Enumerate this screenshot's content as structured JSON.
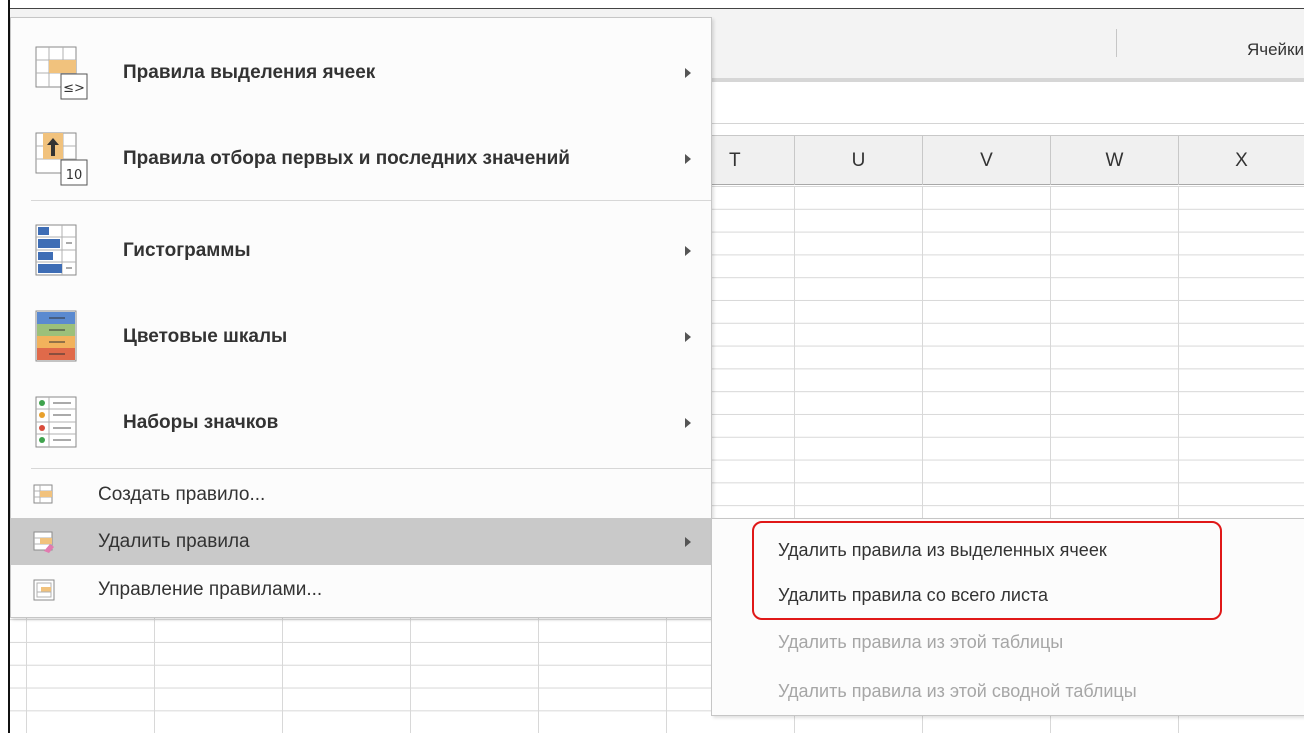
{
  "ribbon": {
    "group_label": "Ячейки"
  },
  "columns": [
    "T",
    "U",
    "V",
    "W",
    "X"
  ],
  "menu": {
    "items": [
      {
        "id": "highlight-cells-rules",
        "label": "Правила выделения ячеек",
        "accel": "р"
      },
      {
        "id": "top-bottom-rules",
        "label": "Правила отбора первых и последних значений",
        "accel": "П"
      },
      {
        "id": "data-bars",
        "label": "Гистограммы",
        "accel": "Г"
      },
      {
        "id": "color-scales",
        "label": "Цветовые шкалы",
        "accel": "ш"
      },
      {
        "id": "icon-sets",
        "label": "Наборы значков",
        "accel": "Н"
      },
      {
        "id": "new-rule",
        "label": "Создать правило...",
        "accel": "С"
      },
      {
        "id": "clear-rules",
        "label": "Удалить правила",
        "accel": "У"
      },
      {
        "id": "manage-rules",
        "label": "Управление правилами...",
        "accel": "и"
      }
    ]
  },
  "submenu": {
    "items": [
      {
        "label": "Удалить правила из выделенных ячеек",
        "enabled": true
      },
      {
        "label": "Удалить правила со всего листа",
        "enabled": true
      },
      {
        "label": "Удалить правила из этой таблицы",
        "enabled": false
      },
      {
        "label": "Удалить правила из этой сводной таблицы",
        "enabled": false
      }
    ]
  },
  "colors": {
    "hover": "#c9c9c9",
    "highlight_border": "#e01818",
    "disabled_text": "#a6a6a6"
  }
}
